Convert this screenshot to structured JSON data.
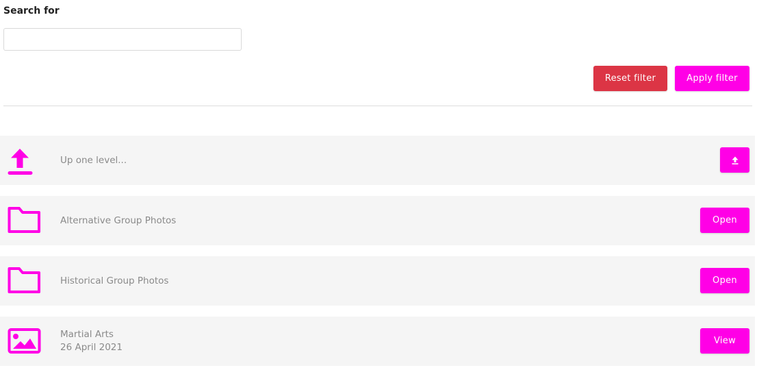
{
  "search": {
    "label": "Search for",
    "value": "",
    "placeholder": ""
  },
  "actions": {
    "reset_label": "Reset filter",
    "apply_label": "Apply filter"
  },
  "colors": {
    "accent": "#ff00e6",
    "danger": "#dc3545",
    "row_background": "#f5f5f5"
  },
  "rows": [
    {
      "icon": "upload-icon",
      "title": "Up one level...",
      "subtitle": "",
      "button_icon": "arrow-up-icon"
    },
    {
      "icon": "folder-icon",
      "title": "Alternative Group Photos",
      "subtitle": "",
      "button_label": "Open"
    },
    {
      "icon": "folder-icon",
      "title": "Historical Group Photos",
      "subtitle": "",
      "button_label": "Open"
    },
    {
      "icon": "image-icon",
      "title": "Martial Arts",
      "subtitle": "26 April 2021",
      "button_label": "View"
    }
  ]
}
